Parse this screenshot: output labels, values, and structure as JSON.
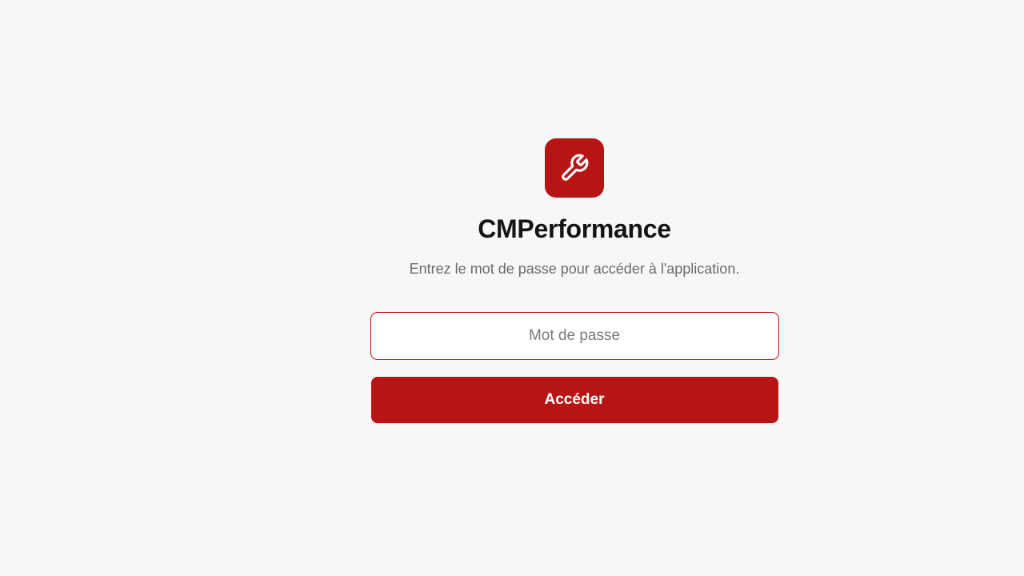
{
  "app": {
    "title": "CMPerformance",
    "subtitle": "Entrez le mot de passe pour accéder à l'application.",
    "logo_icon": "wrench-icon"
  },
  "login": {
    "password_placeholder": "Mot de passe",
    "password_value": "",
    "submit_label": "Accéder"
  },
  "colors": {
    "accent": "#b71414",
    "background": "#f7f7f7",
    "title": "#141414",
    "subtitle": "#6b6b6b"
  }
}
